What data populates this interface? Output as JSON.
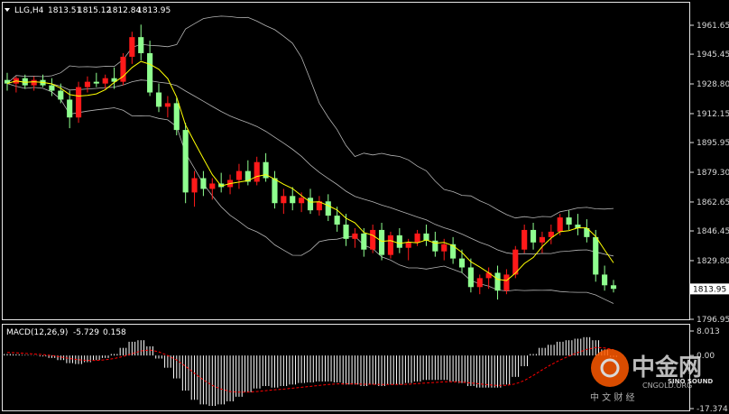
{
  "header": {
    "symbol": "LLG,H4",
    "open": "1813.51",
    "high": "1815.12",
    "low": "1812.84",
    "close": "1813.95"
  },
  "macd_header": {
    "name": "MACD(12,26,9)",
    "main": "-5.729",
    "signal": "0.158"
  },
  "price_axis": [
    "1961.65",
    "1945.45",
    "1928.80",
    "1912.15",
    "1895.95",
    "1879.30",
    "1862.65",
    "1846.45",
    "1829.80",
    "1813.95",
    "1796.95"
  ],
  "current_price": "1813.95",
  "macd_axis": [
    "8.013",
    "0.00",
    "-17.374"
  ],
  "watermark": {
    "brand": "中金网",
    "domain": "CNGOLD.ORG",
    "tagline": "中 文 财 经",
    "sub": "SINO SOUND"
  },
  "colors": {
    "bull": "#ff1a1a",
    "bear": "#8fff8f",
    "ma": "#ffff00",
    "bands": "#b4b4b4",
    "signal": "#ff0000",
    "histogram": "#ffffff"
  },
  "chart_data": {
    "type": "candlestick",
    "symbol": "LLG",
    "timeframe": "H4",
    "ylim": [
      1796.95,
      1961.65
    ],
    "indicators": [
      "Bollinger Bands",
      "Moving Average",
      "MACD(12,26,9)"
    ],
    "candles": [
      {
        "o": 1931,
        "h": 1935,
        "l": 1925,
        "c": 1929
      },
      {
        "o": 1929,
        "h": 1933,
        "l": 1924,
        "c": 1932
      },
      {
        "o": 1932,
        "h": 1934,
        "l": 1926,
        "c": 1928
      },
      {
        "o": 1928,
        "h": 1933,
        "l": 1925,
        "c": 1931
      },
      {
        "o": 1931,
        "h": 1934,
        "l": 1927,
        "c": 1928
      },
      {
        "o": 1928,
        "h": 1932,
        "l": 1922,
        "c": 1925
      },
      {
        "o": 1925,
        "h": 1929,
        "l": 1918,
        "c": 1920
      },
      {
        "o": 1920,
        "h": 1925,
        "l": 1904,
        "c": 1910
      },
      {
        "o": 1910,
        "h": 1930,
        "l": 1907,
        "c": 1927
      },
      {
        "o": 1927,
        "h": 1933,
        "l": 1924,
        "c": 1930
      },
      {
        "o": 1930,
        "h": 1935,
        "l": 1927,
        "c": 1929
      },
      {
        "o": 1929,
        "h": 1934,
        "l": 1926,
        "c": 1932
      },
      {
        "o": 1932,
        "h": 1938,
        "l": 1926,
        "c": 1930
      },
      {
        "o": 1930,
        "h": 1946,
        "l": 1928,
        "c": 1944
      },
      {
        "o": 1944,
        "h": 1958,
        "l": 1940,
        "c": 1955
      },
      {
        "o": 1955,
        "h": 1962,
        "l": 1942,
        "c": 1946
      },
      {
        "o": 1946,
        "h": 1953,
        "l": 1922,
        "c": 1924
      },
      {
        "o": 1924,
        "h": 1929,
        "l": 1913,
        "c": 1916
      },
      {
        "o": 1916,
        "h": 1922,
        "l": 1910,
        "c": 1918
      },
      {
        "o": 1918,
        "h": 1921,
        "l": 1900,
        "c": 1903
      },
      {
        "o": 1903,
        "h": 1907,
        "l": 1862,
        "c": 1868
      },
      {
        "o": 1868,
        "h": 1880,
        "l": 1860,
        "c": 1876
      },
      {
        "o": 1876,
        "h": 1880,
        "l": 1866,
        "c": 1870
      },
      {
        "o": 1870,
        "h": 1876,
        "l": 1864,
        "c": 1873
      },
      {
        "o": 1873,
        "h": 1879,
        "l": 1868,
        "c": 1871
      },
      {
        "o": 1871,
        "h": 1878,
        "l": 1867,
        "c": 1875
      },
      {
        "o": 1875,
        "h": 1884,
        "l": 1870,
        "c": 1880
      },
      {
        "o": 1880,
        "h": 1886,
        "l": 1872,
        "c": 1874
      },
      {
        "o": 1874,
        "h": 1888,
        "l": 1872,
        "c": 1885
      },
      {
        "o": 1885,
        "h": 1890,
        "l": 1874,
        "c": 1876
      },
      {
        "o": 1876,
        "h": 1880,
        "l": 1859,
        "c": 1862
      },
      {
        "o": 1862,
        "h": 1870,
        "l": 1856,
        "c": 1866
      },
      {
        "o": 1866,
        "h": 1871,
        "l": 1858,
        "c": 1862
      },
      {
        "o": 1862,
        "h": 1868,
        "l": 1857,
        "c": 1865
      },
      {
        "o": 1865,
        "h": 1870,
        "l": 1856,
        "c": 1858
      },
      {
        "o": 1858,
        "h": 1866,
        "l": 1855,
        "c": 1863
      },
      {
        "o": 1863,
        "h": 1867,
        "l": 1852,
        "c": 1855
      },
      {
        "o": 1855,
        "h": 1860,
        "l": 1846,
        "c": 1850
      },
      {
        "o": 1850,
        "h": 1856,
        "l": 1838,
        "c": 1842
      },
      {
        "o": 1842,
        "h": 1848,
        "l": 1837,
        "c": 1845
      },
      {
        "o": 1845,
        "h": 1848,
        "l": 1832,
        "c": 1836
      },
      {
        "o": 1836,
        "h": 1850,
        "l": 1834,
        "c": 1847
      },
      {
        "o": 1847,
        "h": 1851,
        "l": 1830,
        "c": 1833
      },
      {
        "o": 1833,
        "h": 1846,
        "l": 1831,
        "c": 1844
      },
      {
        "o": 1844,
        "h": 1848,
        "l": 1834,
        "c": 1837
      },
      {
        "o": 1837,
        "h": 1842,
        "l": 1830,
        "c": 1840
      },
      {
        "o": 1840,
        "h": 1847,
        "l": 1838,
        "c": 1845
      },
      {
        "o": 1845,
        "h": 1850,
        "l": 1838,
        "c": 1841
      },
      {
        "o": 1841,
        "h": 1846,
        "l": 1832,
        "c": 1835
      },
      {
        "o": 1835,
        "h": 1842,
        "l": 1830,
        "c": 1839
      },
      {
        "o": 1839,
        "h": 1843,
        "l": 1828,
        "c": 1831
      },
      {
        "o": 1831,
        "h": 1836,
        "l": 1823,
        "c": 1826
      },
      {
        "o": 1826,
        "h": 1831,
        "l": 1812,
        "c": 1815
      },
      {
        "o": 1815,
        "h": 1822,
        "l": 1811,
        "c": 1820
      },
      {
        "o": 1820,
        "h": 1826,
        "l": 1814,
        "c": 1823
      },
      {
        "o": 1823,
        "h": 1827,
        "l": 1808,
        "c": 1813
      },
      {
        "o": 1813,
        "h": 1825,
        "l": 1811,
        "c": 1822
      },
      {
        "o": 1822,
        "h": 1838,
        "l": 1820,
        "c": 1836
      },
      {
        "o": 1836,
        "h": 1850,
        "l": 1834,
        "c": 1847
      },
      {
        "o": 1847,
        "h": 1851,
        "l": 1836,
        "c": 1840
      },
      {
        "o": 1840,
        "h": 1846,
        "l": 1834,
        "c": 1843
      },
      {
        "o": 1843,
        "h": 1850,
        "l": 1839,
        "c": 1846
      },
      {
        "o": 1846,
        "h": 1856,
        "l": 1844,
        "c": 1854
      },
      {
        "o": 1854,
        "h": 1858,
        "l": 1847,
        "c": 1850
      },
      {
        "o": 1850,
        "h": 1856,
        "l": 1844,
        "c": 1848
      },
      {
        "o": 1848,
        "h": 1853,
        "l": 1840,
        "c": 1843
      },
      {
        "o": 1843,
        "h": 1847,
        "l": 1818,
        "c": 1822
      },
      {
        "o": 1822,
        "h": 1827,
        "l": 1813,
        "c": 1816
      },
      {
        "o": 1816,
        "h": 1819,
        "l": 1812,
        "c": 1814
      }
    ],
    "macd_ylim": [
      -17.374,
      8.013
    ],
    "macd_histogram": [
      0.5,
      0.4,
      0.2,
      0.1,
      -0.3,
      -0.8,
      -1.5,
      -2.5,
      -2.8,
      -2.2,
      -1.5,
      -0.8,
      0.5,
      2.5,
      4.5,
      5.0,
      3.0,
      -1.0,
      -4.0,
      -7.5,
      -11.5,
      -14.5,
      -16.0,
      -16.5,
      -16.0,
      -15.0,
      -13.5,
      -12.0,
      -10.8,
      -10.0,
      -10.5,
      -10.0,
      -9.5,
      -9.0,
      -8.8,
      -8.5,
      -8.5,
      -8.8,
      -9.5,
      -9.5,
      -10.0,
      -9.5,
      -10.0,
      -9.5,
      -9.5,
      -9.0,
      -8.5,
      -8.0,
      -8.0,
      -8.0,
      -8.5,
      -9.0,
      -10.0,
      -10.5,
      -10.5,
      -10.5,
      -9.5,
      -7.0,
      -3.5,
      0.5,
      2.5,
      3.5,
      4.5,
      5.0,
      5.5,
      6.0,
      5.0,
      2.0,
      -0.5
    ],
    "macd_signal": [
      1.0,
      0.9,
      0.7,
      0.5,
      0.3,
      0.0,
      -0.5,
      -1.0,
      -1.4,
      -1.6,
      -1.6,
      -1.4,
      -1.0,
      -0.3,
      0.6,
      1.5,
      1.8,
      1.2,
      0.0,
      -1.5,
      -3.5,
      -5.8,
      -8.0,
      -9.8,
      -11.0,
      -11.8,
      -12.0,
      -12.0,
      -11.8,
      -11.5,
      -11.2,
      -11.0,
      -10.7,
      -10.4,
      -10.1,
      -9.8,
      -9.5,
      -9.3,
      -9.3,
      -9.3,
      -9.4,
      -9.4,
      -9.5,
      -9.5,
      -9.5,
      -9.4,
      -9.2,
      -9.0,
      -8.8,
      -8.6,
      -8.6,
      -8.7,
      -9.0,
      -9.3,
      -9.6,
      -9.8,
      -9.8,
      -9.3,
      -8.2,
      -6.5,
      -4.7,
      -3.0,
      -1.5,
      -0.2,
      1.0,
      2.0,
      2.6,
      2.5,
      1.9
    ]
  }
}
